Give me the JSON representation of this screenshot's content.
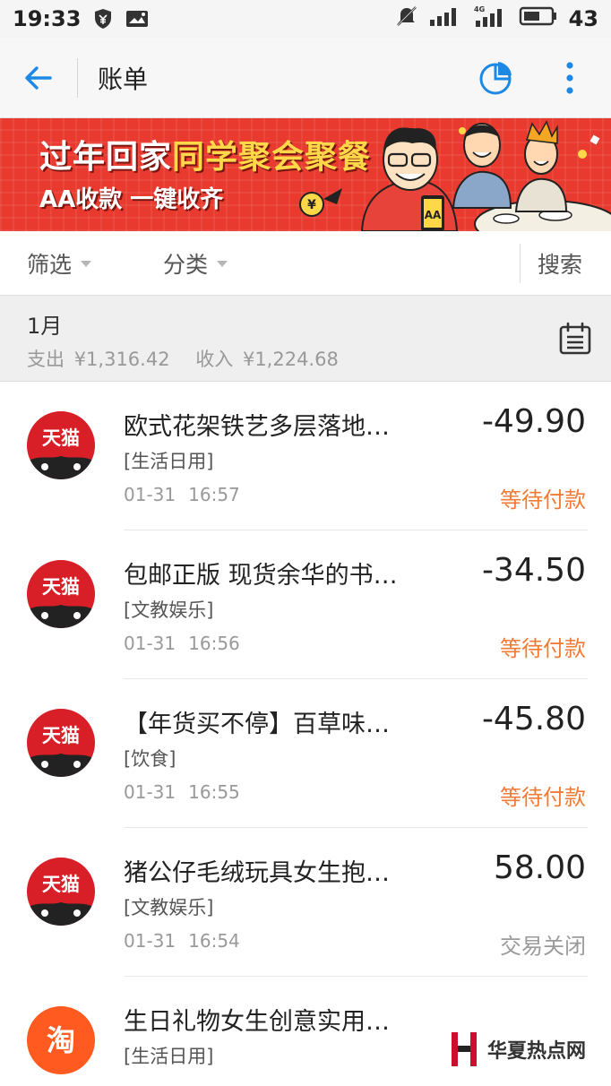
{
  "status_bar": {
    "time": "19:33",
    "network": "4G",
    "battery": "43"
  },
  "header": {
    "title": "账单"
  },
  "banner": {
    "headline_part1": "过年回家",
    "headline_part2": "同学聚会聚餐",
    "subline": "AA收款 一键收齐",
    "phone_text": "AA"
  },
  "filters": {
    "filter_label": "筛选",
    "category_label": "分类",
    "search_label": "搜索"
  },
  "month": {
    "label": "1月",
    "expense_label": "支出",
    "expense_value": "¥1,316.42",
    "income_label": "收入",
    "income_value": "¥1,224.68"
  },
  "transactions": [
    {
      "merchant_icon": "tmall-icon",
      "merchant_logo_text": "天猫",
      "title": "欧式花架铁艺多层落地…",
      "category": "[生活日用]",
      "date": "01-31",
      "time": "16:57",
      "amount": "-49.90",
      "status": "等待付款",
      "status_type": "waiting"
    },
    {
      "merchant_icon": "tmall-icon",
      "merchant_logo_text": "天猫",
      "title": "包邮正版 现货余华的书…",
      "category": "[文教娱乐]",
      "date": "01-31",
      "time": "16:56",
      "amount": "-34.50",
      "status": "等待付款",
      "status_type": "waiting"
    },
    {
      "merchant_icon": "tmall-icon",
      "merchant_logo_text": "天猫",
      "title": "【年货买不停】百草味…",
      "category": "[饮食]",
      "date": "01-31",
      "time": "16:55",
      "amount": "-45.80",
      "status": "等待付款",
      "status_type": "waiting"
    },
    {
      "merchant_icon": "tmall-icon",
      "merchant_logo_text": "天猫",
      "title": "猪公仔毛绒玩具女生抱…",
      "category": "[文教娱乐]",
      "date": "01-31",
      "time": "16:54",
      "amount": "58.00",
      "status": "交易关闭",
      "status_type": "closed"
    },
    {
      "merchant_icon": "taobao-icon",
      "merchant_logo_text": "淘",
      "title": "生日礼物女生创意实用…",
      "category": "[生活日用]",
      "date": "",
      "time": "",
      "amount": "",
      "status": "",
      "status_type": ""
    }
  ],
  "watermark": {
    "text": "华夏热点网"
  },
  "colors": {
    "accent_blue": "#1e88e5",
    "waiting_orange": "#f07b36",
    "tmall_red": "#d81e26",
    "taobao_orange": "#ff5a1f",
    "banner_red": "#e83a2e"
  }
}
